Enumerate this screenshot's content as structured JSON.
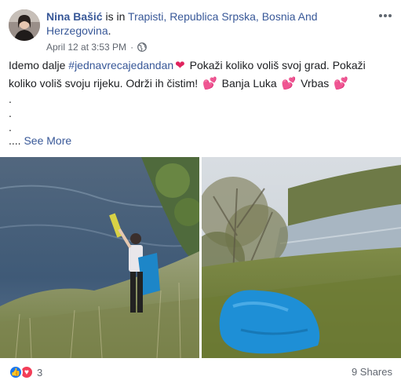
{
  "post": {
    "author": "Nina Bašić",
    "is_in": " is in ",
    "location": "Trapisti, Republica Srpska, Bosnia And Herzegovina",
    "location_end": ".",
    "timestamp": "April 12 at 3:53 PM",
    "separator": "·",
    "text_part1": "Idemo dalje ",
    "hashtag": "#jednavrecajedandan",
    "text_part2": " Pokaži koliko voliš svoj grad. Pokaži koliko voliš svoju rijeku. Održi ih čistim! ",
    "text_part3": " Banja Luka ",
    "text_part4": " Vrbas ",
    "dot1": ".",
    "dot2": ".",
    "dot3": ".",
    "see_more_prefix": ".... ",
    "see_more": "See More"
  },
  "footer": {
    "reaction_count": "3",
    "shares": "9 Shares"
  },
  "icons": {
    "like": "like-icon",
    "love": "love-icon",
    "globe": "globe-icon",
    "more": "more-icon",
    "heart": "heart-icon"
  },
  "colors": {
    "link": "#385898",
    "like": "#1877f2",
    "love": "#f33e58",
    "heart": "#e0245e"
  }
}
